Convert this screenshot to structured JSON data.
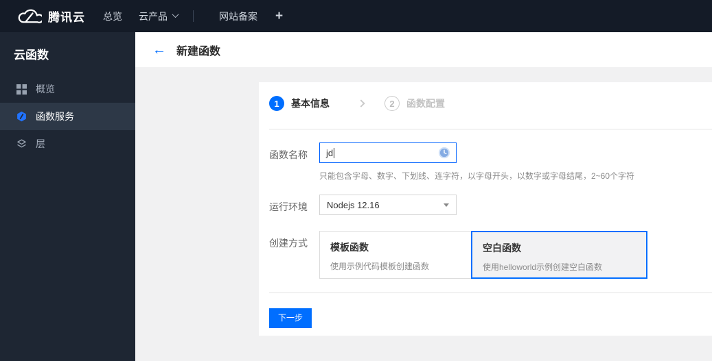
{
  "topnav": {
    "brand": "腾讯云",
    "overview": "总览",
    "products": "云产品",
    "beian": "网站备案",
    "plus": "+"
  },
  "sidebar": {
    "title": "云函数",
    "items": [
      {
        "label": "概览",
        "icon": "grid-icon",
        "selected": false
      },
      {
        "label": "函数服务",
        "icon": "scf-hexagon-icon",
        "selected": true
      },
      {
        "label": "层",
        "icon": "layers-icon",
        "selected": false
      }
    ]
  },
  "header": {
    "title": "新建函数"
  },
  "wizard": {
    "steps": [
      {
        "num": "1",
        "label": "基本信息",
        "active": true
      },
      {
        "num": "2",
        "label": "函数配置",
        "active": false
      }
    ]
  },
  "form": {
    "name_label": "函数名称",
    "name_value": "jd",
    "name_hint": "只能包含字母、数字、下划线、连字符，以字母开头，以数字或字母结尾，2~60个字符",
    "runtime_label": "运行环境",
    "runtime_value": "Nodejs 12.16",
    "method_label": "创建方式",
    "methods": [
      {
        "title": "模板函数",
        "desc": "使用示例代码模板创建函数",
        "selected": false
      },
      {
        "title": "空白函数",
        "desc": "使用helloworld示例创建空白函数",
        "selected": true
      }
    ],
    "next_label": "下一步"
  },
  "colors": {
    "accent_blue": "#006eff",
    "topnav_bg": "#141b27",
    "sidebar_bg": "#1e2633",
    "sidebar_selected_bg": "#2d3847",
    "content_bg": "#f1f1f2",
    "selected_card_bg": "#f2f2f3"
  }
}
